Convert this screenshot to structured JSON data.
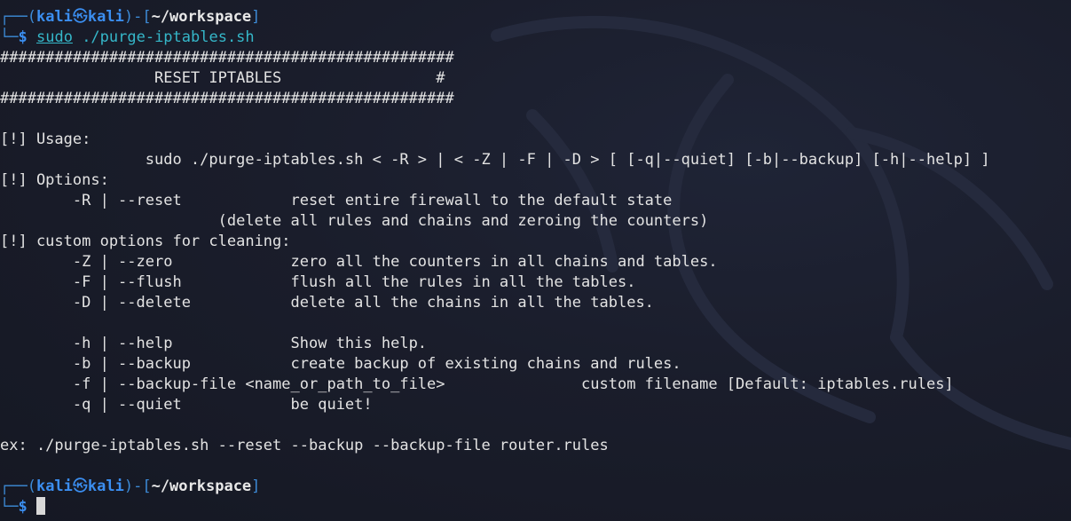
{
  "prompt": {
    "user": "kali",
    "host": "kali",
    "skull": "㉿",
    "cwd": "~/workspace",
    "dollar": "$"
  },
  "command": {
    "sudo": "sudo",
    "rest": "./purge-iptables.sh"
  },
  "output": [
    "##################################################",
    "                 RESET IPTABLES                 #",
    "##################################################",
    "",
    "[!] Usage:",
    "                sudo ./purge-iptables.sh < -R > | < -Z | -F | -D > [ [-q|--quiet] [-b|--backup] [-h|--help] ]",
    "[!] Options:",
    "        -R | --reset            reset entire firewall to the default state",
    "                        (delete all rules and chains and zeroing the counters)",
    "[!] custom options for cleaning:",
    "        -Z | --zero             zero all the counters in all chains and tables.",
    "        -F | --flush            flush all the rules in all the tables.",
    "        -D | --delete           delete all the chains in all the tables.",
    "",
    "        -h | --help             Show this help.",
    "        -b | --backup           create backup of existing chains and rules.",
    "        -f | --backup-file <name_or_path_to_file>               custom filename [Default: iptables.rules]",
    "        -q | --quiet            be quiet!",
    "",
    "ex: ./purge-iptables.sh --reset --backup --backup-file router.rules",
    ""
  ],
  "colors": {
    "background": "#1a1d2b",
    "prompt_blue": "#3b8ef0",
    "command_cyan": "#35b7c9",
    "text": "#e3e3e3"
  }
}
